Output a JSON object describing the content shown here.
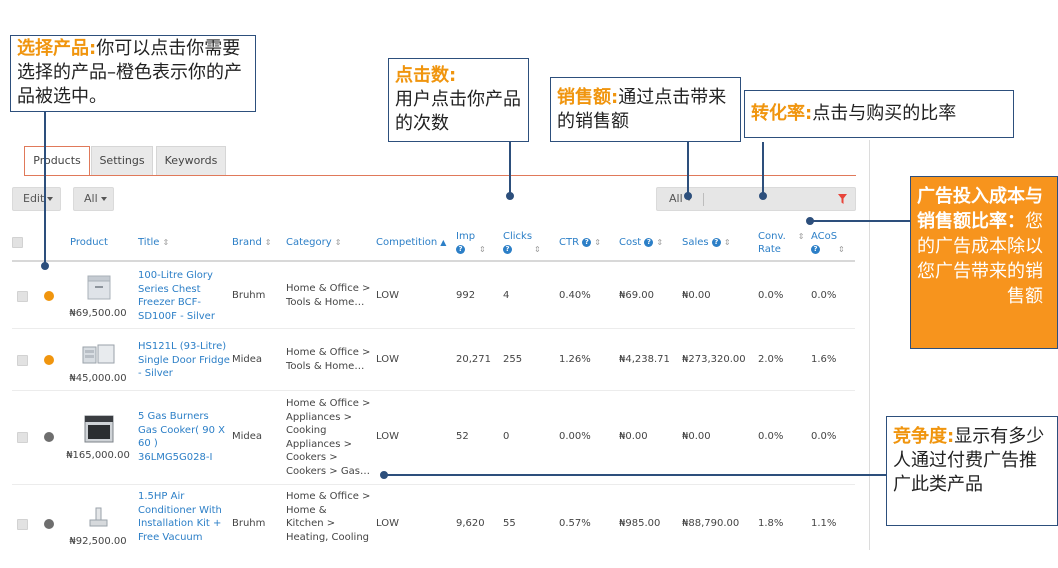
{
  "tabs": [
    "Products",
    "Settings",
    "Keywords"
  ],
  "toolbar": {
    "edit_label": "Edit",
    "all_label": "All",
    "filter_select": "All"
  },
  "columns": {
    "product": "Product",
    "title": "Title",
    "brand": "Brand",
    "category": "Category",
    "competition": "Competition",
    "imp": "Imp",
    "clicks": "Clicks",
    "ctr": "CTR",
    "cost": "Cost",
    "sales": "Sales",
    "conv_rate_1": "Conv.",
    "conv_rate_2": "Rate",
    "acos": "ACoS"
  },
  "rows": [
    {
      "selected": true,
      "price": "₦69,500.00",
      "title": [
        "100-Litre Glory",
        "Series Chest",
        "Freezer BCF-",
        "SD100F - Silver"
      ],
      "brand": "Bruhm",
      "category": [
        "Home & Office >",
        "Tools & Home…"
      ],
      "competition": "LOW",
      "imp": "992",
      "clicks": "4",
      "ctr": "0.40%",
      "cost": "₦69.00",
      "sales": "₦0.00",
      "conv_rate": "0.0%",
      "acos": "0.0%"
    },
    {
      "selected": true,
      "price": "₦45,000.00",
      "title": [
        "HS121L (93-Litre)",
        "Single Door Fridge",
        "- Silver"
      ],
      "brand": "Midea",
      "category": [
        "Home & Office >",
        "Tools & Home…"
      ],
      "competition": "LOW",
      "imp": "20,271",
      "clicks": "255",
      "ctr": "1.26%",
      "cost": "₦4,238.71",
      "sales": "₦273,320.00",
      "conv_rate": "2.0%",
      "acos": "1.6%"
    },
    {
      "selected": false,
      "price": "₦165,000.00",
      "title": [
        "5 Gas Burners",
        "Gas Cooker( 90 X",
        "60 )",
        "36LMG5G028-I"
      ],
      "brand": "Midea",
      "category": [
        "Home & Office >",
        "Appliances >",
        "Cooking",
        "Appliances >",
        "Cookers >",
        "Cookers > Gas…"
      ],
      "competition": "LOW",
      "imp": "52",
      "clicks": "0",
      "ctr": "0.00%",
      "cost": "₦0.00",
      "sales": "₦0.00",
      "conv_rate": "0.0%",
      "acos": "0.0%"
    },
    {
      "selected": false,
      "price": "₦92,500.00",
      "title": [
        "1.5HP Air",
        "Conditioner With",
        "Installation Kit +",
        "Free Vacuum"
      ],
      "brand": "Bruhm",
      "category": [
        "Home & Office >",
        "Home &",
        "Kitchen >",
        "Heating, Cooling"
      ],
      "competition": "LOW",
      "imp": "9,620",
      "clicks": "55",
      "ctr": "0.57%",
      "cost": "₦985.00",
      "sales": "₦88,790.00",
      "conv_rate": "1.8%",
      "acos": "1.1%"
    }
  ],
  "annotations": {
    "select": {
      "heading": "选择产品:",
      "text": "你可以点击你需要选择的产品–橙色表示你的产品被选中。"
    },
    "clicks": {
      "heading": "点击数:",
      "text": "用户点击你产品的次数"
    },
    "sales": {
      "heading": "销售额:",
      "text": "通过点击带来的销售额"
    },
    "conv": {
      "heading": "转化率:",
      "text": "点击与购买的比率"
    },
    "acos": {
      "heading": "广告投入成本与销售额比率：",
      "text": "您的广告成本除以您广告带来的销售额"
    },
    "competition": {
      "heading": "竞争度:",
      "text": "显示有多少人通过付费广告推广此类产品"
    }
  },
  "colors": {
    "accent": "#e0795a",
    "link": "#2c7fc7",
    "highlight": "#f0950e",
    "selected_dot": "#f0950e",
    "unselected_dot": "#6e6e6e",
    "note_border": "#2d4f7c"
  }
}
